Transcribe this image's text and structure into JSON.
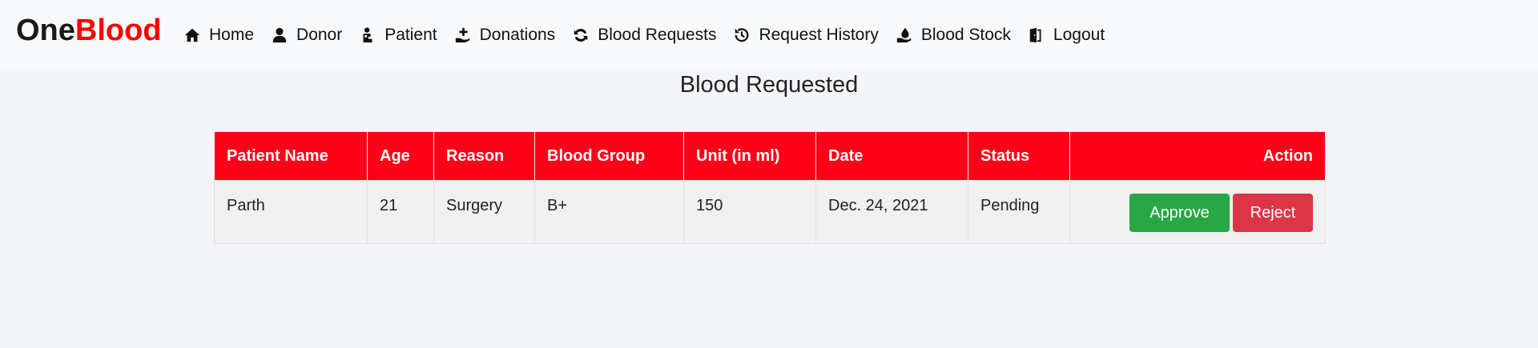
{
  "brand": {
    "part1": "One",
    "part2": "Blood"
  },
  "nav": {
    "items": [
      {
        "label": "Home",
        "icon": "home-icon"
      },
      {
        "label": "Donor",
        "icon": "user-icon"
      },
      {
        "label": "Patient",
        "icon": "patient-icon"
      },
      {
        "label": "Donations",
        "icon": "hand-plus-icon"
      },
      {
        "label": "Blood Requests",
        "icon": "refresh-icon"
      },
      {
        "label": "Request History",
        "icon": "history-icon"
      },
      {
        "label": "Blood Stock",
        "icon": "hand-drop-icon"
      },
      {
        "label": "Logout",
        "icon": "door-icon"
      }
    ]
  },
  "page_title": "Blood Requested",
  "table": {
    "headers": [
      "Patient Name",
      "Age",
      "Reason",
      "Blood Group",
      "Unit (in ml)",
      "Date",
      "Status",
      "Action"
    ],
    "rows": [
      {
        "patient_name": "Parth",
        "age": "21",
        "reason": "Surgery",
        "blood_group": "B+",
        "unit": "150",
        "date": "Dec. 24, 2021",
        "status": "Pending",
        "approve_label": "Approve",
        "reject_label": "Reject"
      }
    ]
  },
  "colors": {
    "brand_red": "#ff0000",
    "header_red": "#ff0018",
    "approve_green": "#28a745",
    "reject_red": "#dc3545"
  }
}
